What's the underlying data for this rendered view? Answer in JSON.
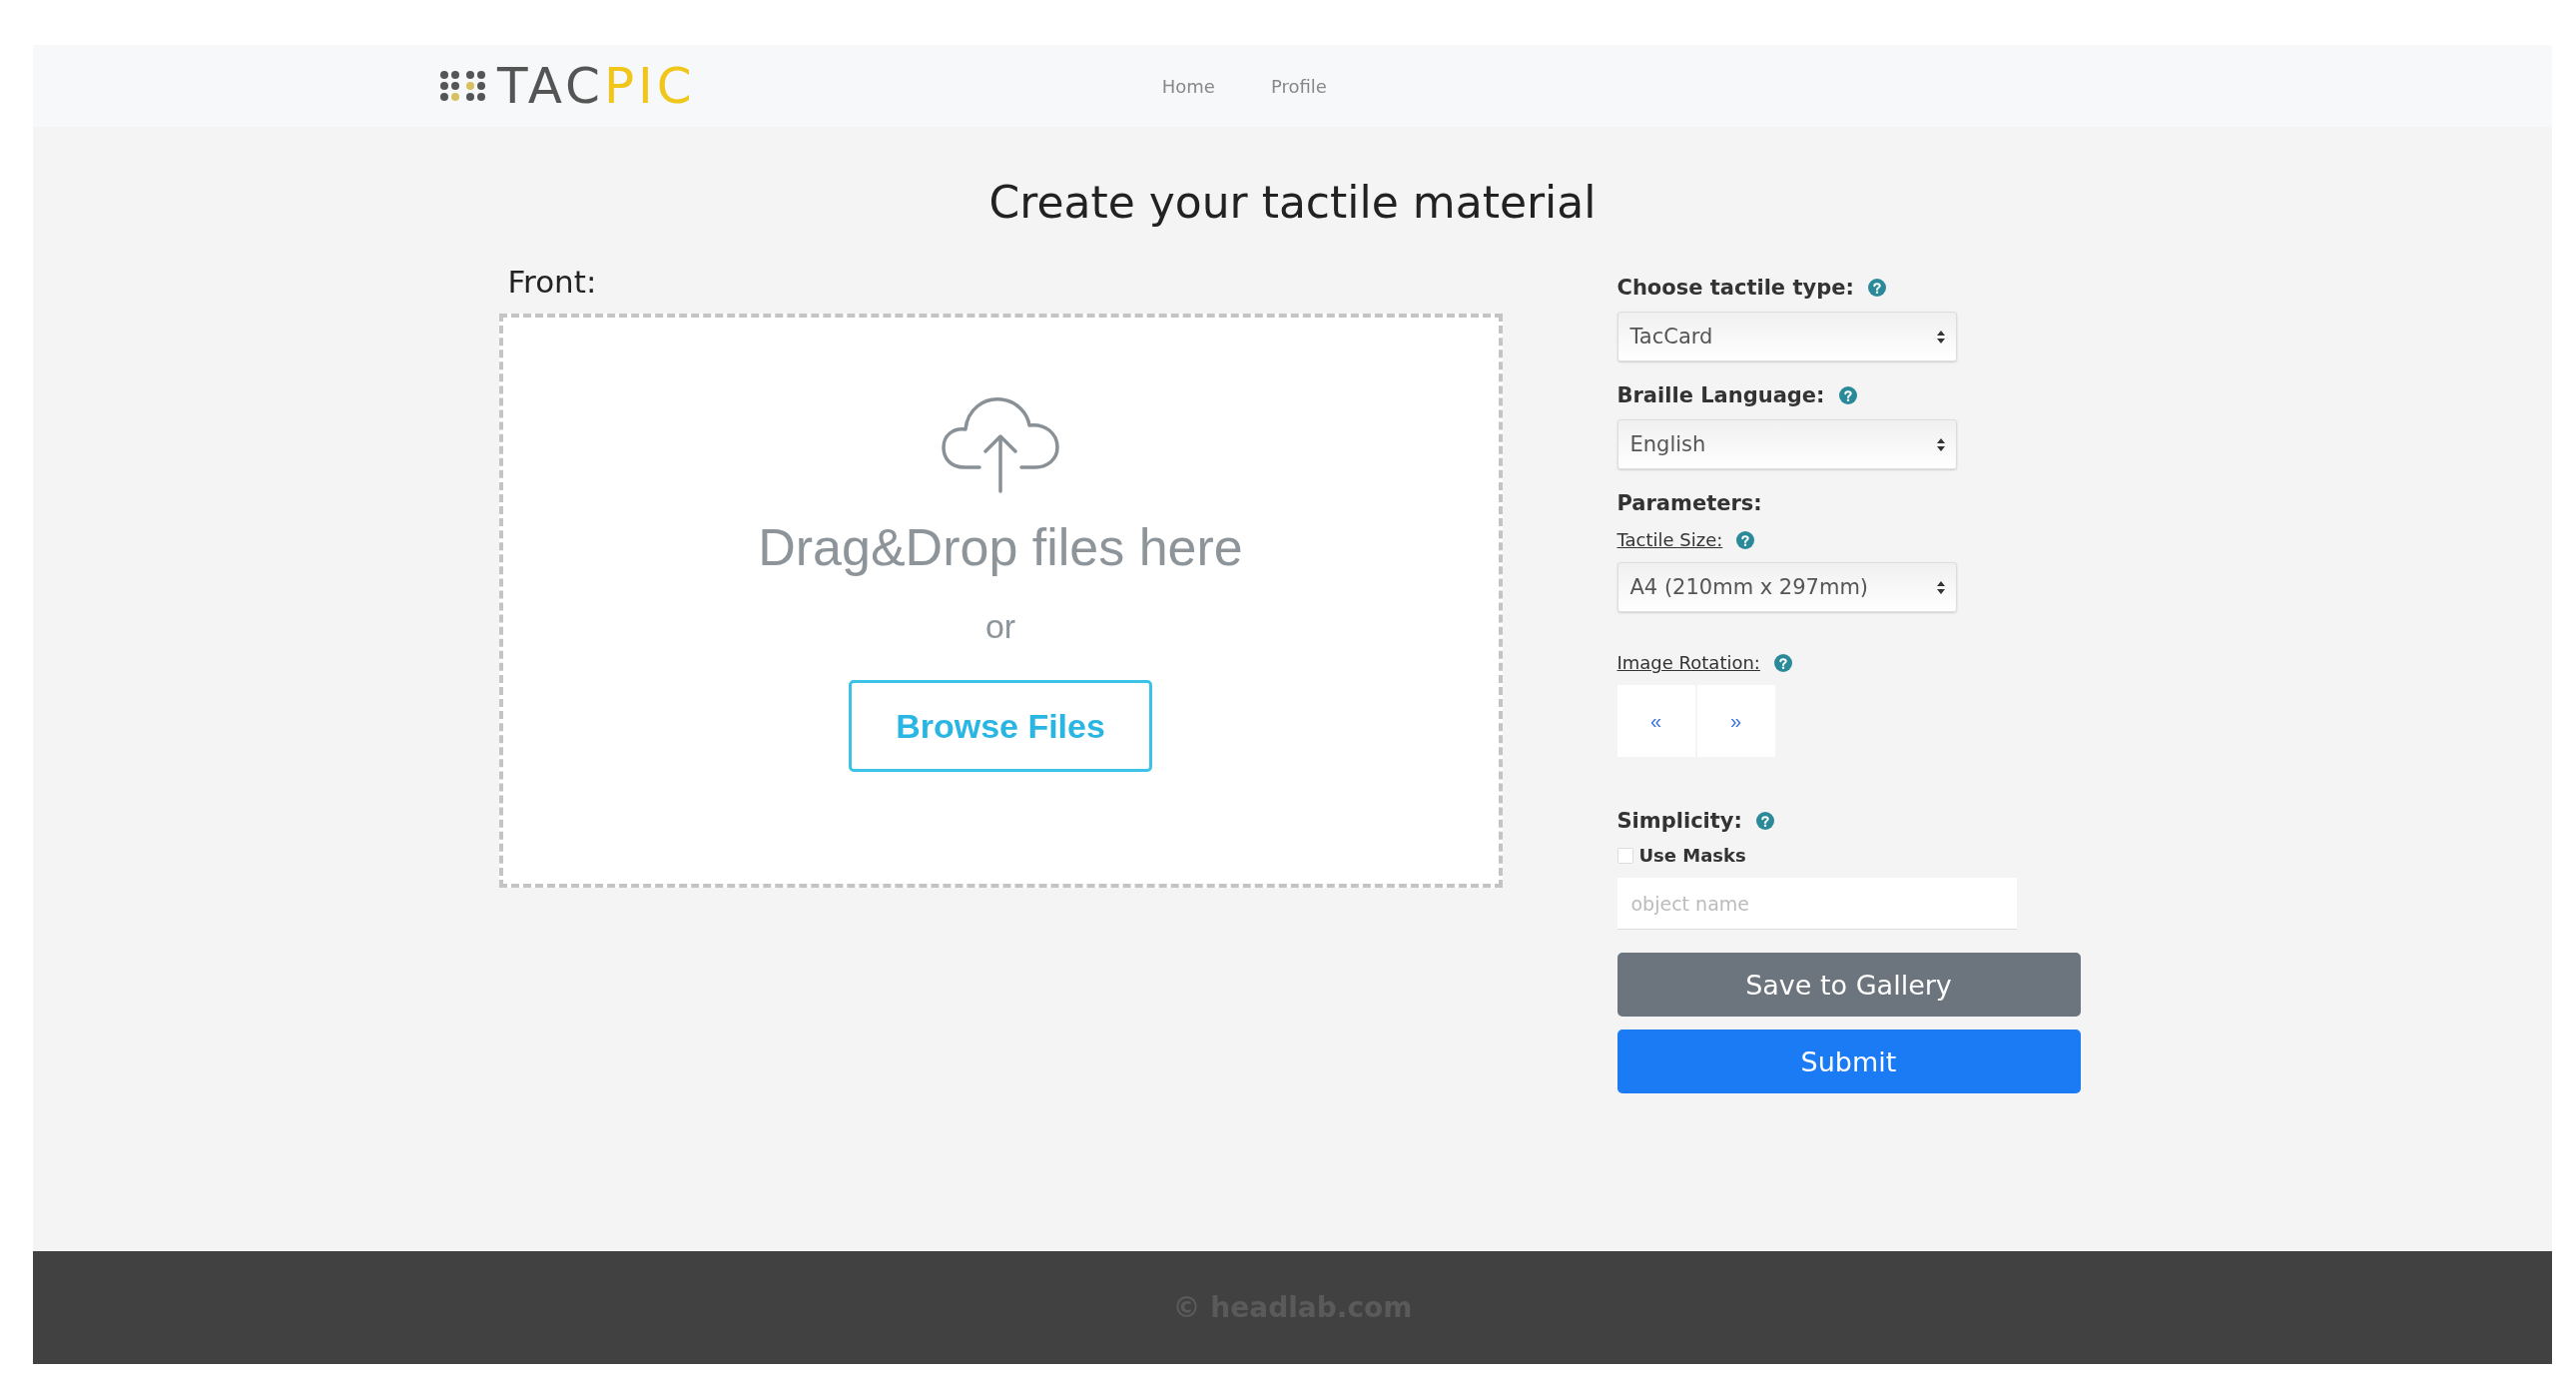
{
  "navbar": {
    "logo": {
      "dark": "TAC",
      "accent": "PIC"
    },
    "links": [
      {
        "label": "Home"
      },
      {
        "label": "Profile"
      }
    ]
  },
  "title": "Create your tactile material",
  "upload": {
    "label": "Front:",
    "drop_text": "Drag&Drop files here",
    "or_text": "or",
    "browse_button": "Browse Files"
  },
  "form": {
    "tactile_type": {
      "label": "Choose tactile type:",
      "value": "TacCard"
    },
    "braille_language": {
      "label": "Braille Language:",
      "value": "English"
    },
    "parameters_heading": "Parameters:",
    "tactile_size": {
      "label": "Tactile Size:",
      "value": "A4 (210mm x 297mm)"
    },
    "image_rotation": {
      "label": "Image Rotation:",
      "buttons": [
        "«",
        "»"
      ]
    },
    "simplicity": {
      "label": "Simplicity:",
      "use_masks": {
        "label": "Use Masks",
        "checked": false
      },
      "object_name": {
        "placeholder": "object name"
      }
    },
    "buttons": [
      {
        "label": "Save to Gallery",
        "kind": "secondary"
      },
      {
        "label": "Submit",
        "kind": "primary"
      }
    ]
  },
  "footer": "© headlab.com"
}
